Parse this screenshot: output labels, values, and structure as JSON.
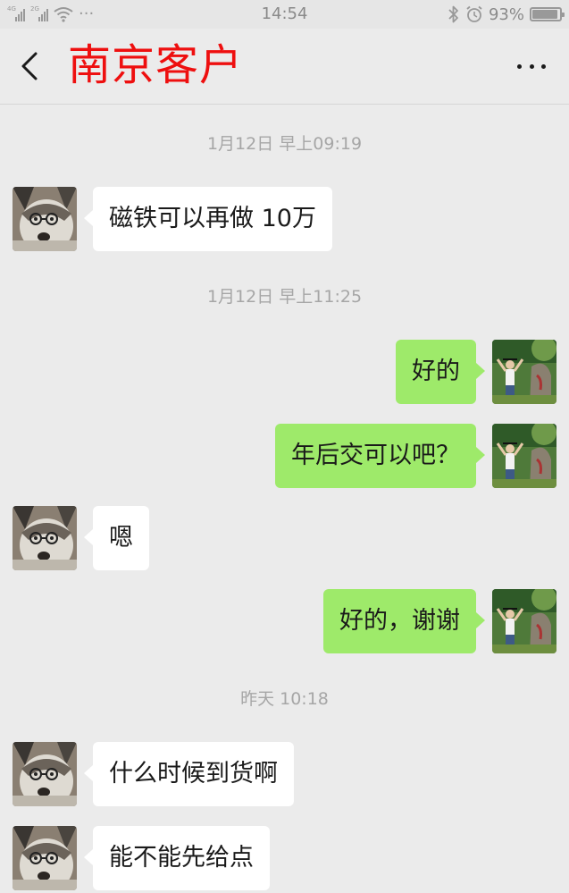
{
  "status_bar": {
    "network_tag_1": "4G",
    "network_tag_2": "2G",
    "more_dots": "···",
    "time": "14:54",
    "battery_percent": "93%",
    "battery_level": 0.93
  },
  "header": {
    "title": "南京客户"
  },
  "messages": [
    {
      "kind": "timestamp",
      "text": "1月12日 早上09:19"
    },
    {
      "kind": "message",
      "side": "in",
      "text": "磁铁可以再做 10万"
    },
    {
      "kind": "timestamp",
      "text": "1月12日 早上11:25"
    },
    {
      "kind": "message",
      "side": "out",
      "text": "好的"
    },
    {
      "kind": "message",
      "side": "out",
      "text": "年后交可以吧？"
    },
    {
      "kind": "message",
      "side": "in",
      "text": "嗯"
    },
    {
      "kind": "message",
      "side": "out",
      "text": "好的，谢谢"
    },
    {
      "kind": "timestamp",
      "text": "昨天 10:18"
    },
    {
      "kind": "message",
      "side": "in",
      "text": "什么时候到货啊"
    },
    {
      "kind": "message",
      "side": "in",
      "text": "能不能先给点"
    }
  ],
  "colors": {
    "background": "#ebebeb",
    "incoming_bubble": "#ffffff",
    "outgoing_bubble": "#9eea6a",
    "title": "#ee0f0f"
  }
}
